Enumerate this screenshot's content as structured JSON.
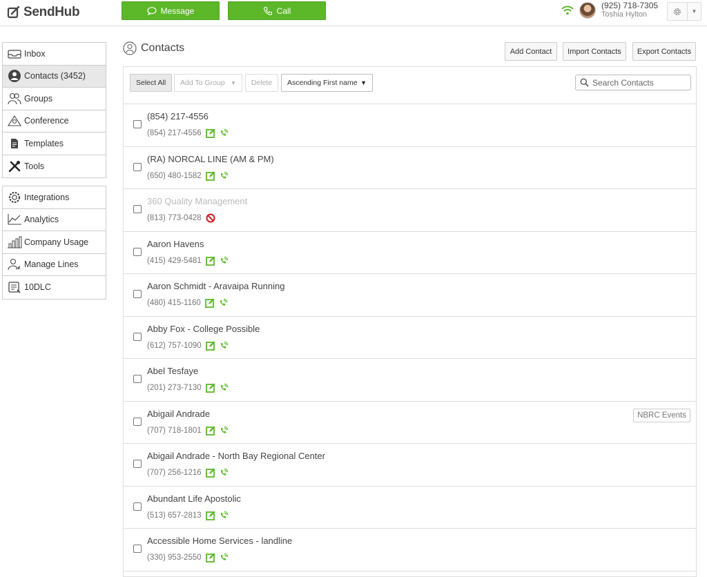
{
  "app": {
    "name": "SendHub"
  },
  "header": {
    "message_label": "Message",
    "call_label": "Call",
    "user_phone": "(925) 718-7305",
    "user_name": "Toshia Hylton"
  },
  "sidebar": {
    "primary": [
      {
        "label": "Inbox",
        "icon": "inbox-icon"
      },
      {
        "label": "Contacts (3452)",
        "icon": "contacts-icon",
        "active": true
      },
      {
        "label": "Groups",
        "icon": "groups-icon"
      },
      {
        "label": "Conference",
        "icon": "conference-icon"
      },
      {
        "label": "Templates",
        "icon": "templates-icon"
      },
      {
        "label": "Tools",
        "icon": "tools-icon"
      }
    ],
    "secondary": [
      {
        "label": "Integrations",
        "icon": "integrations-icon"
      },
      {
        "label": "Analytics",
        "icon": "analytics-icon"
      },
      {
        "label": "Company Usage",
        "icon": "company-usage-icon"
      },
      {
        "label": "Manage Lines",
        "icon": "manage-lines-icon"
      },
      {
        "label": "10DLC",
        "icon": "10dlc-icon"
      }
    ]
  },
  "page": {
    "title": "Contacts",
    "add_contact": "Add Contact",
    "import_contacts": "Import Contacts",
    "export_contacts": "Export Contacts"
  },
  "toolbar": {
    "select_all": "Select All",
    "add_to_group": "Add To Group",
    "delete": "Delete",
    "sort": "Ascending First name",
    "search_placeholder": "Search Contacts"
  },
  "contacts": [
    {
      "name": "(854) 217-4556",
      "phone": "(854) 217-4556",
      "status": "active"
    },
    {
      "name": "(RA) NORCAL LINE (AM & PM)",
      "phone": "(650) 480-1582",
      "status": "active"
    },
    {
      "name": "360 Quality Management",
      "phone": "(813) 773-0428",
      "status": "blocked"
    },
    {
      "name": "Aaron Havens",
      "phone": "(415) 429-5481",
      "status": "active"
    },
    {
      "name": "Aaron Schmidt - Aravaipa Running",
      "phone": "(480) 415-1160",
      "status": "active"
    },
    {
      "name": "Abby Fox - College Possible",
      "phone": "(612) 757-1090",
      "status": "active"
    },
    {
      "name": "Abel Tesfaye",
      "phone": "(201) 273-7130",
      "status": "active"
    },
    {
      "name": "Abigail Andrade",
      "phone": "(707) 718-1801",
      "status": "active",
      "tag": "NBRC Events"
    },
    {
      "name": "Abigail Andrade - North Bay Regional Center",
      "phone": "(707) 256-1216",
      "status": "active"
    },
    {
      "name": "Abundant Life Apostolic",
      "phone": "(513) 657-2813",
      "status": "active"
    },
    {
      "name": "Accessible Home Services - landline",
      "phone": "(330) 953-2550",
      "status": "active"
    }
  ],
  "colors": {
    "accent_green": "#5cb829",
    "blocked_red": "#cc1f1f"
  }
}
